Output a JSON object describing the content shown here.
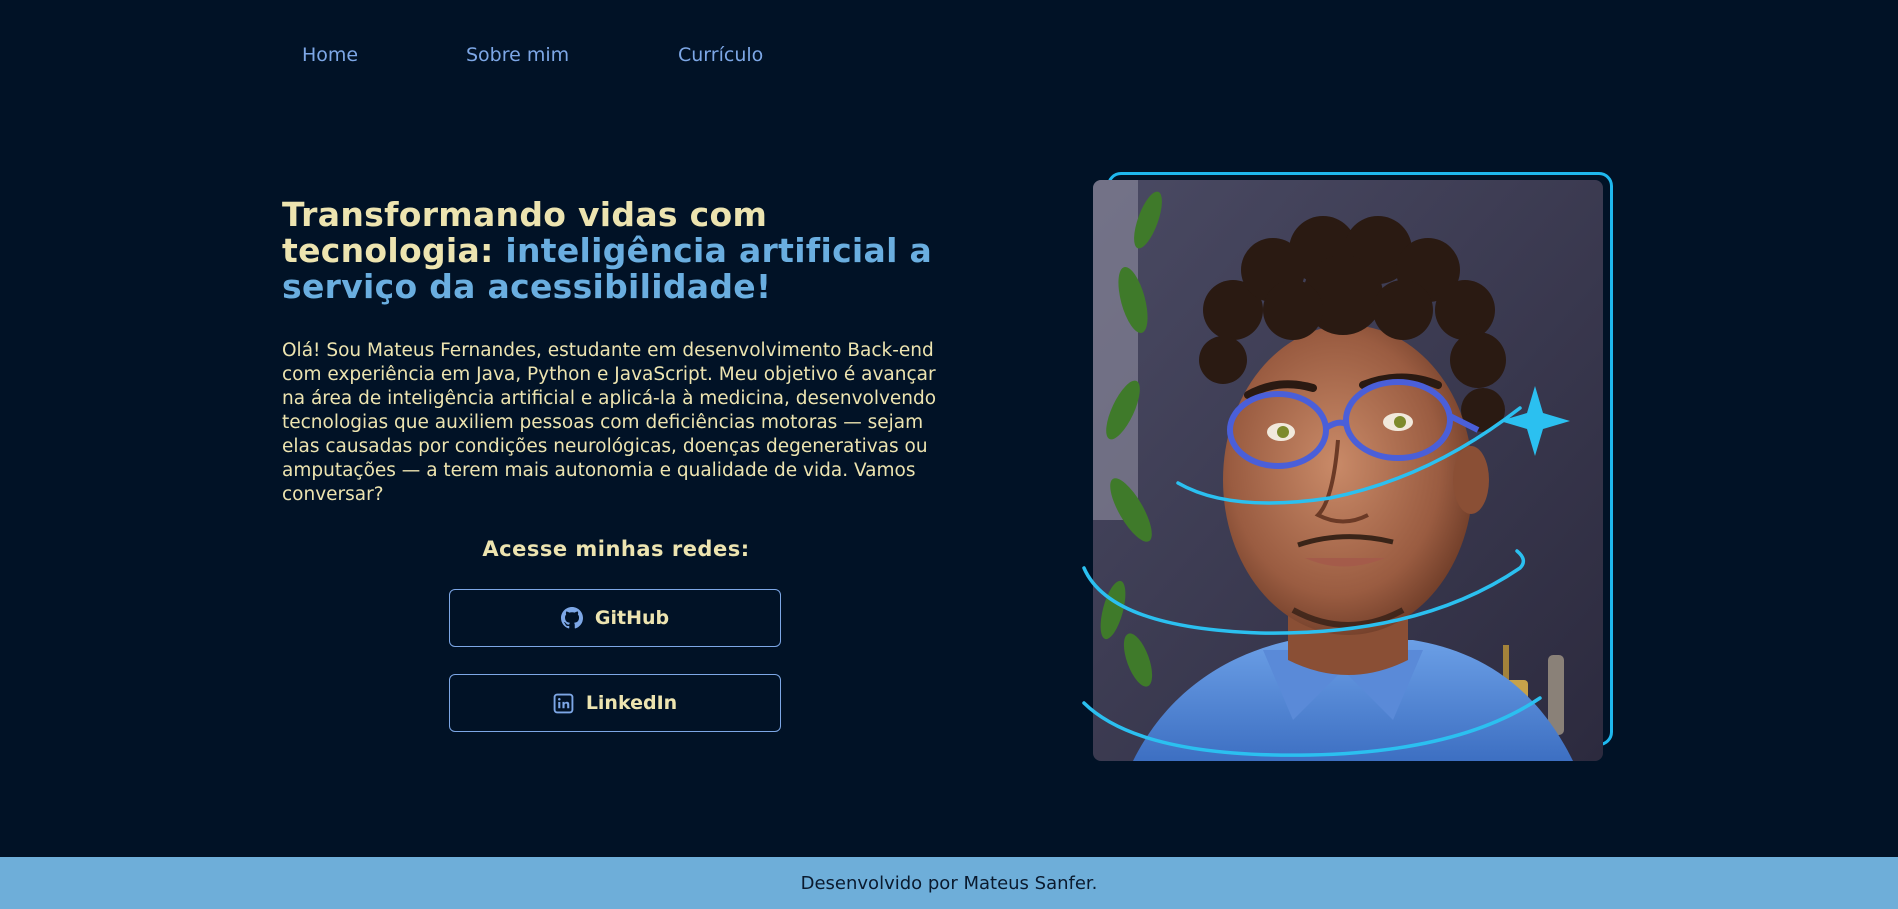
{
  "nav": {
    "items": [
      "Home",
      "Sobre mim",
      "Currículo"
    ]
  },
  "hero": {
    "title_part1": "Transformando vidas com tecnologia: ",
    "title_part2": "inteligência artificial a serviço da acessibilidade!",
    "bio": "Olá! Sou Mateus Fernandes, estudante em desenvolvimento Back-end com experiência em Java, Python e JavaScript. Meu objetivo é avançar na área de inteligência artificial e aplicá-la à medicina, desenvolvendo tecnologias que auxiliem pessoas com deficiências motoras — sejam elas causadas por condições neurológicas, doenças degenerativas ou amputações — a terem mais autonomia e qualidade de vida. Vamos conversar?"
  },
  "social": {
    "heading": "Acesse minhas redes:",
    "github_label": "GitHub",
    "github_icon": "github-icon",
    "linkedin_label": "LinkedIn",
    "linkedin_icon": "linkedin-icon"
  },
  "portrait": {
    "alt": "Mateus Fernandes"
  },
  "footer": {
    "text": "Desenvolvido por Mateus Sanfer."
  },
  "colors": {
    "background": "#011226",
    "cream": "#ede4b0",
    "accent_blue": "#6aaee0",
    "nav_blue": "#7da7e6",
    "frame_cyan": "#1fb8ef",
    "footer_bg": "#6eaed9"
  }
}
